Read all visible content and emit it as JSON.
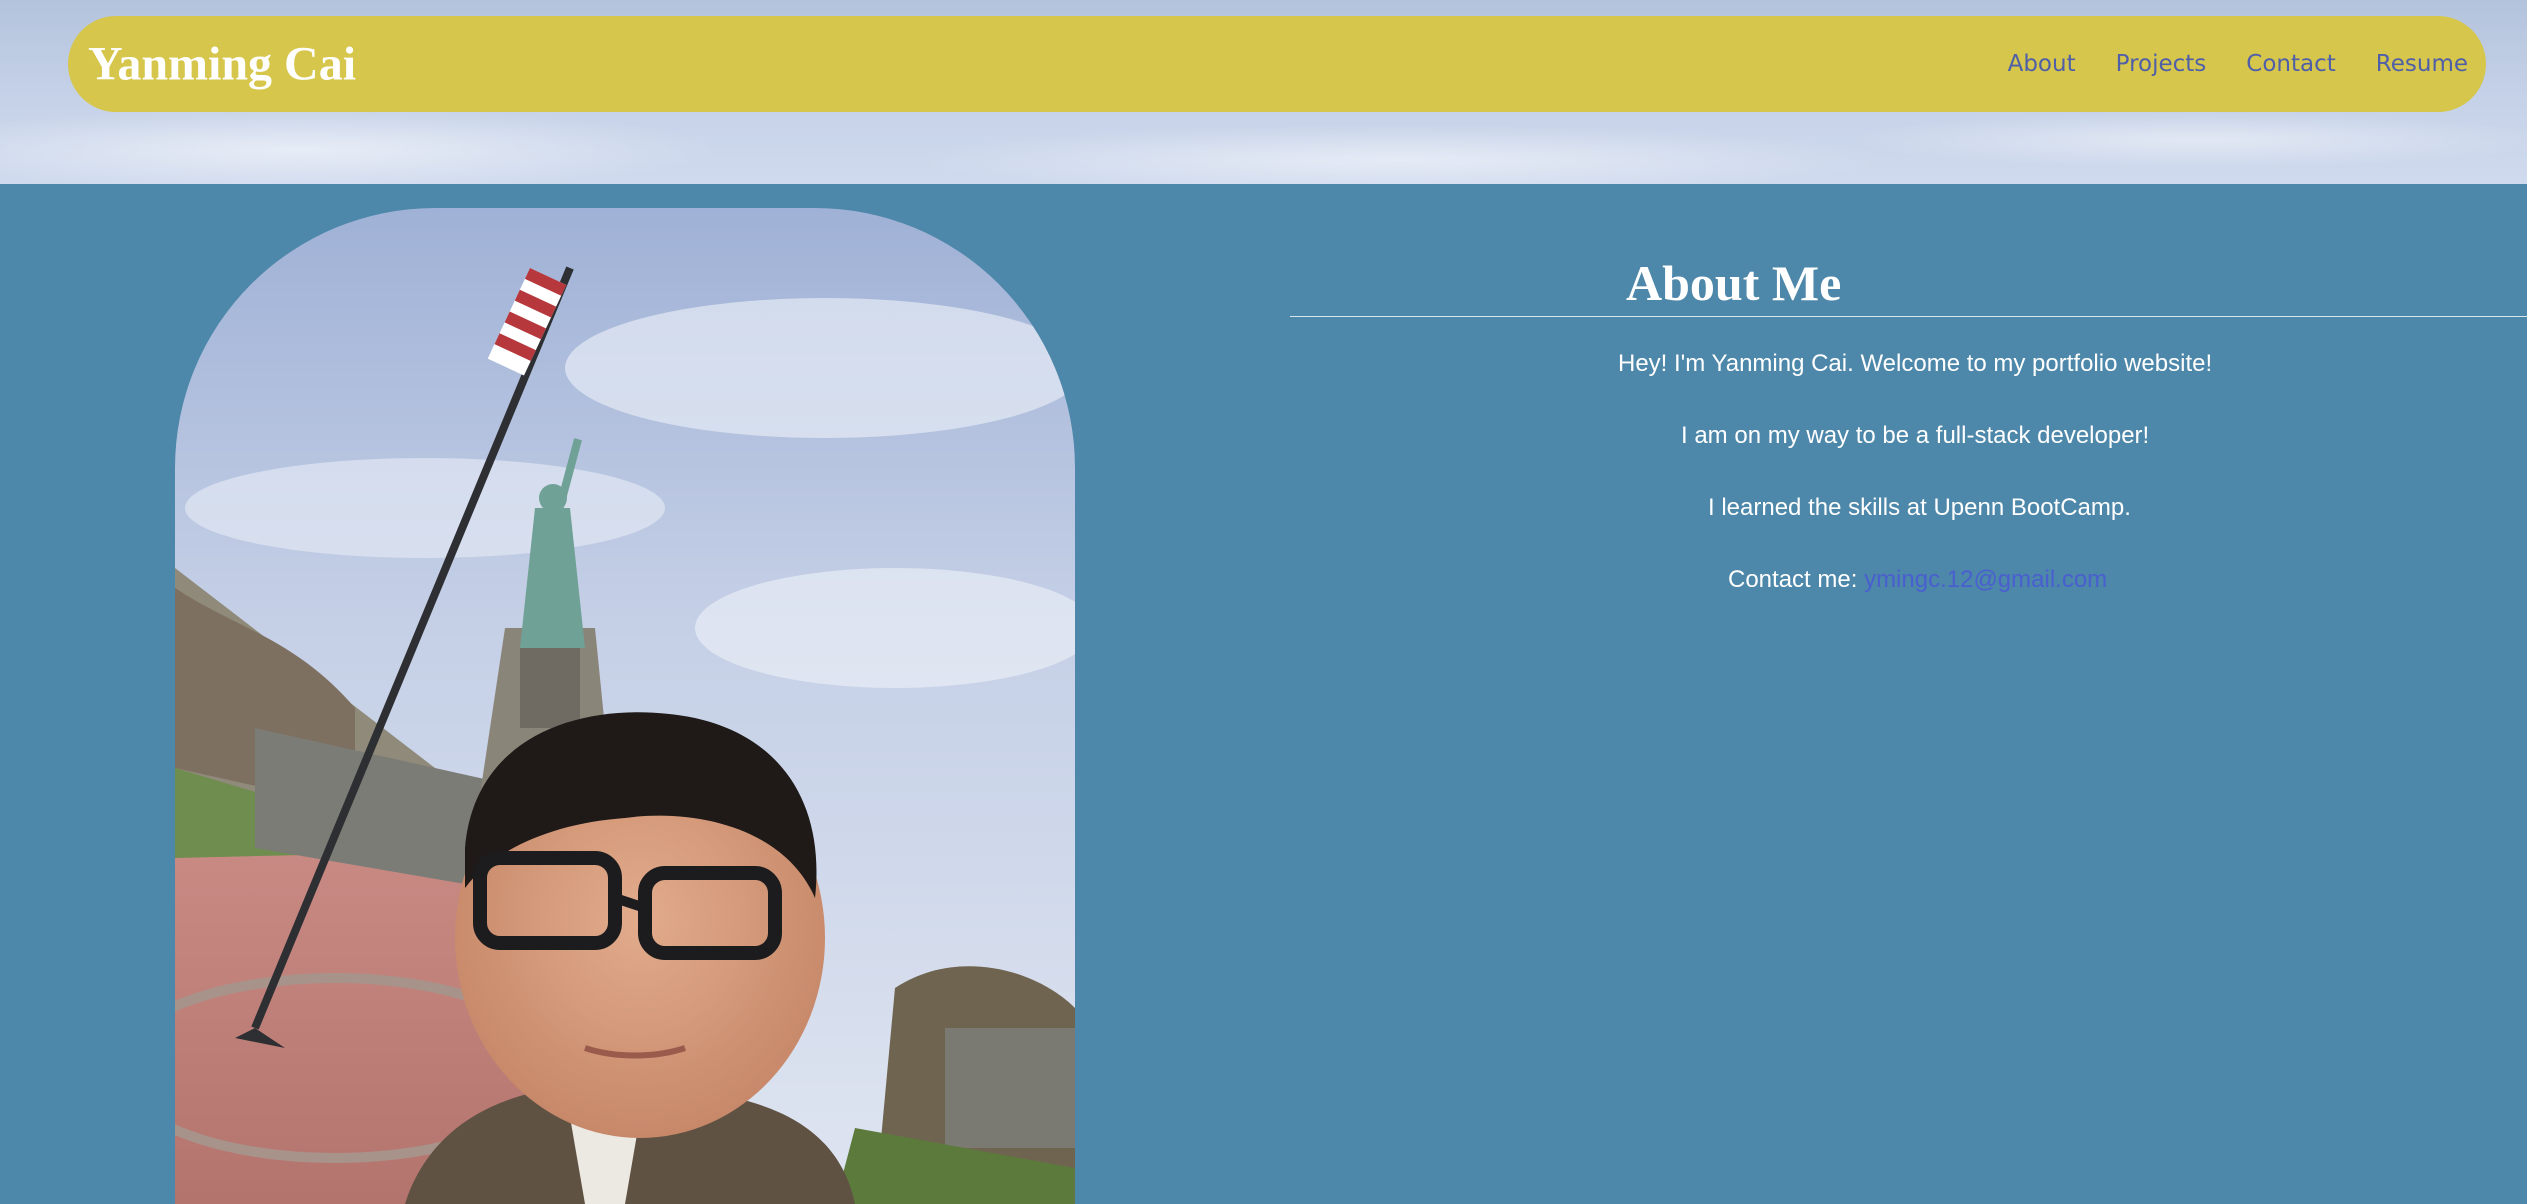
{
  "header": {
    "brand": "Yanming Cai",
    "nav": [
      {
        "label": "About"
      },
      {
        "label": "Projects"
      },
      {
        "label": "Contact"
      },
      {
        "label": "Resume"
      }
    ]
  },
  "about": {
    "heading": "About Me",
    "lines": [
      "Hey! I'm Yanming Cai. Welcome to my portfolio website!",
      "I am on my way to be a full-stack developer!",
      "I learned the skills at Upenn BootCamp."
    ],
    "contact_label": "Contact me:",
    "contact_email": "ymingc.12@gmail.com"
  },
  "colors": {
    "page_bg": "#4d87a9",
    "navbar_bg": "#d6c64c",
    "nav_link": "#4f5fa8",
    "email_link": "#4a5fcf"
  }
}
